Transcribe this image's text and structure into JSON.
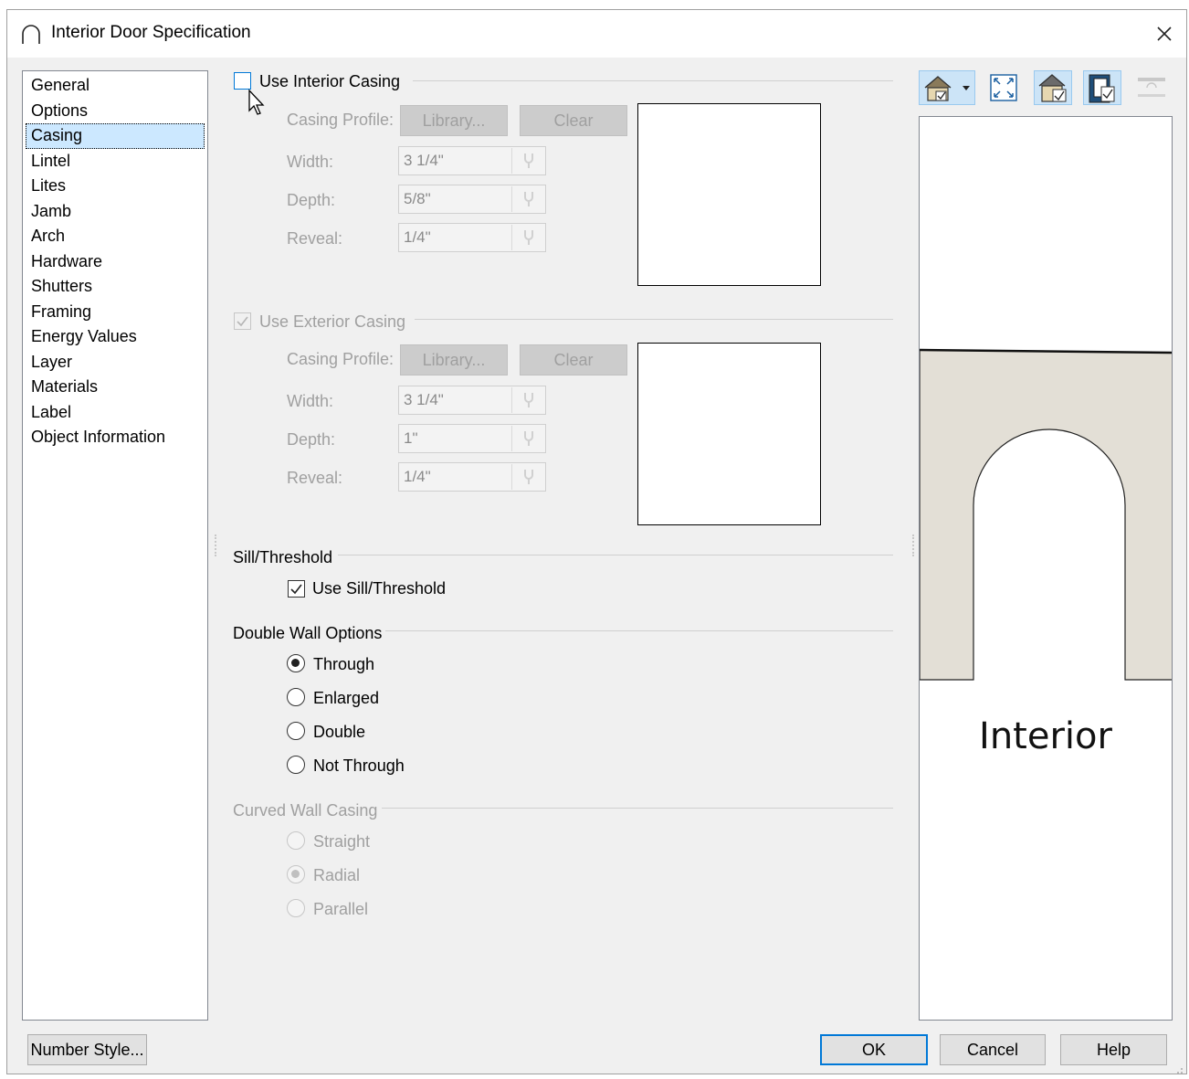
{
  "window": {
    "title": "Interior Door Specification"
  },
  "nav": {
    "items": [
      "General",
      "Options",
      "Casing",
      "Lintel",
      "Lites",
      "Jamb",
      "Arch",
      "Hardware",
      "Shutters",
      "Framing",
      "Energy Values",
      "Layer",
      "Materials",
      "Label",
      "Object Information"
    ],
    "selected": "Casing"
  },
  "interior_casing": {
    "header": "Use Interior Casing",
    "checked": false,
    "profile_label": "Casing Profile:",
    "library_label": "Library...",
    "clear_label": "Clear",
    "width_label": "Width:",
    "width_value": "3 1/4\"",
    "depth_label": "Depth:",
    "depth_value": "5/8\"",
    "reveal_label": "Reveal:",
    "reveal_value": "1/4\""
  },
  "exterior_casing": {
    "header": "Use Exterior Casing",
    "checked": true,
    "profile_label": "Casing Profile:",
    "library_label": "Library...",
    "clear_label": "Clear",
    "width_label": "Width:",
    "width_value": "3 1/4\"",
    "depth_label": "Depth:",
    "depth_value": "1\"",
    "reveal_label": "Reveal:",
    "reveal_value": "1/4\""
  },
  "sill": {
    "header": "Sill/Threshold",
    "use_label": "Use Sill/Threshold",
    "checked": true
  },
  "double_wall": {
    "header": "Double Wall Options",
    "options": [
      "Through",
      "Enlarged",
      "Double",
      "Not Through"
    ],
    "selected": "Through"
  },
  "curved_wall": {
    "header": "Curved Wall Casing",
    "options": [
      "Straight",
      "Radial",
      "Parallel"
    ],
    "selected": "Radial",
    "enabled": false
  },
  "preview": {
    "label": "Interior",
    "wall_color": "#e3dfd6",
    "toolbar_icons": [
      "view-mode-icon",
      "fit-window-icon",
      "show-house-icon",
      "show-casing-icon",
      "reset-icon"
    ]
  },
  "buttons": {
    "number_style": "Number Style...",
    "ok": "OK",
    "cancel": "Cancel",
    "help": "Help"
  },
  "colors": {
    "selection": "#cce8ff",
    "accent": "#0078d7"
  }
}
